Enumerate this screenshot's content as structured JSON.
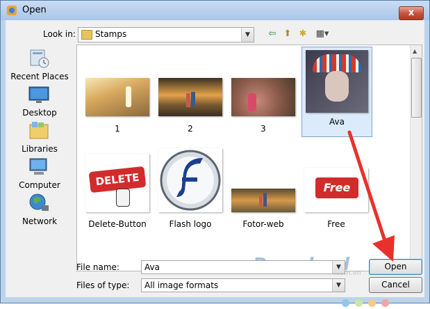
{
  "window": {
    "title": "Open",
    "close_glyph": "x"
  },
  "lookin": {
    "label": "Look in:",
    "value": "Stamps"
  },
  "toolbar": {
    "back_glyph": "⇦",
    "up_glyph": "⬆",
    "newfolder_glyph": "✱",
    "views_glyph": "▦▾"
  },
  "places": [
    {
      "label": "Recent Places",
      "icon": "recent-places-icon"
    },
    {
      "label": "Desktop",
      "icon": "desktop-icon"
    },
    {
      "label": "Libraries",
      "icon": "libraries-icon"
    },
    {
      "label": "Computer",
      "icon": "computer-icon"
    },
    {
      "label": "Network",
      "icon": "network-icon"
    }
  ],
  "files": [
    {
      "name": "1"
    },
    {
      "name": "2"
    },
    {
      "name": "3"
    },
    {
      "name": "Ava",
      "selected": true
    },
    {
      "name": "Delete-Button"
    },
    {
      "name": "Flash logo"
    },
    {
      "name": "Fotor-web"
    },
    {
      "name": "Free"
    }
  ],
  "thumbtext": {
    "delete": "DELETE",
    "free": "Free"
  },
  "filename": {
    "label": "File name:",
    "value": "Ava"
  },
  "filetype": {
    "label": "Files of type:",
    "value": "All image formats"
  },
  "buttons": {
    "open": "Open",
    "cancel": "Cancel"
  },
  "watermark": {
    "text": "Download",
    "sub": ".com.vn"
  },
  "colors": {
    "accent_arrow": "#e8312b",
    "selection": "#dcebfc"
  }
}
